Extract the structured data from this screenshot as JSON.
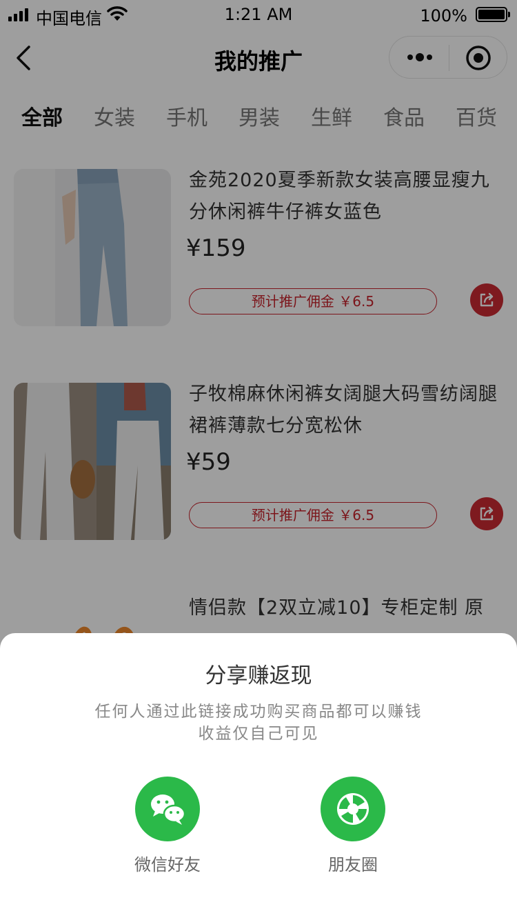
{
  "status": {
    "carrier": "中国电信",
    "time": "1:21 AM",
    "battery": "100%"
  },
  "nav": {
    "title": "我的推广"
  },
  "tabs": [
    {
      "label": "全部"
    },
    {
      "label": "女装"
    },
    {
      "label": "手机"
    },
    {
      "label": "男装"
    },
    {
      "label": "生鲜"
    },
    {
      "label": "食品"
    },
    {
      "label": "百货"
    }
  ],
  "products": [
    {
      "title": "金苑2020夏季新款女装高腰显瘦九分休闲裤牛仔裤女蓝色",
      "price": "¥159",
      "commission": "预计推广佣金 ￥6.5"
    },
    {
      "title": "子牧棉麻休闲裤女阔腿大码雪纺阔腿裙裤薄款七分宽松休",
      "price": "¥59",
      "commission": "预计推广佣金 ￥6.5"
    },
    {
      "title": "情侣款【2双立减10】专柜定制 原"
    }
  ],
  "share_sheet": {
    "title": "分享赚返现",
    "desc_line1": "任何人通过此链接成功购买商品都可以赚钱",
    "desc_line2": "收益仅自己可见",
    "options": [
      {
        "label": "微信好友"
      },
      {
        "label": "朋友圈"
      }
    ]
  },
  "colors": {
    "accent": "#c8232c",
    "wechat_green": "#2bb949"
  }
}
